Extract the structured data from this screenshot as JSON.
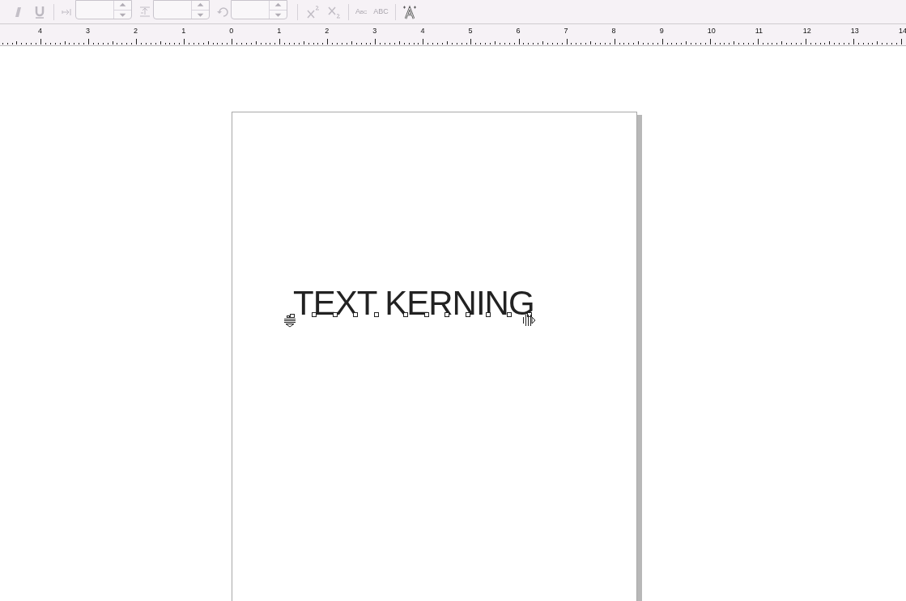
{
  "toolbar": {
    "spinboxes": [
      {
        "kind": "indent"
      },
      {
        "kind": "spacing"
      },
      {
        "kind": "rotation"
      }
    ],
    "case_buttons": [
      {
        "label": "Abc",
        "kind": "smallcaps"
      },
      {
        "label": "ABC",
        "kind": "allcaps"
      }
    ]
  },
  "ruler": {
    "labels": [
      "4",
      "3",
      "2",
      "1",
      "0",
      "1",
      "2",
      "3",
      "4",
      "5",
      "6",
      "7",
      "8",
      "9",
      "10",
      "11",
      "12",
      "13",
      "14"
    ]
  },
  "page": {
    "text": "TEXT KERNING"
  }
}
